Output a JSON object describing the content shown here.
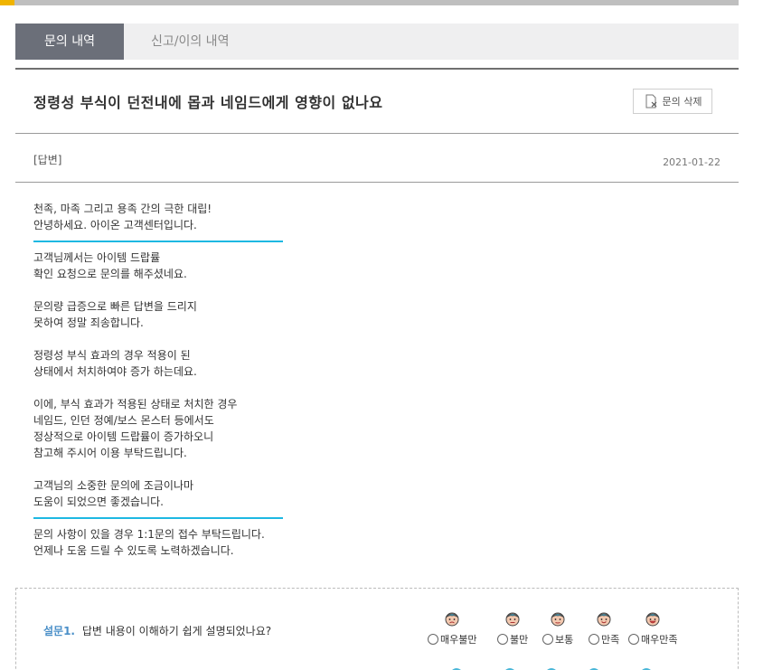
{
  "tabs": {
    "inquiry_history": "문의 내역",
    "report_history": "신고/이의 내역"
  },
  "question": {
    "title": "정령성 부식이 던전내에 몹과 네임드에게 영향이 없나요",
    "delete_label": "문의 삭제"
  },
  "answer": {
    "tag": "[답변]",
    "date": "2021-01-22",
    "greeting": "천족, 마족 그리고 용족 간의 극한 대립!\n안녕하세요. 아이온 고객센터입니다.",
    "paragraphs": [
      "고객님께서는 아이템 드랍률\n확인 요청으로 문의를 해주셨네요.",
      "문의량 급증으로 빠른 답변을 드리지\n못하여 정말 죄송합니다.",
      "정령성 부식 효과의 경우 적용이 된\n상태에서 처치하여야 증가 하는데요.",
      "이에, 부식 효과가 적용된 상태로 처치한 경우\n네임드, 인던 정예/보스 몬스터 등에서도\n정상적으로 아이템 드랍률이 증가하오니\n참고해 주시어 이용 부탁드립니다.",
      "고객님의 소중한 문의에 조금이나마\n도움이 되었으면 좋겠습니다."
    ],
    "closing": "문의 사항이 있을 경우 1:1문의 접수 부탁드립니다.\n언제나 도움 드릴 수 있도록 노력하겠습니다."
  },
  "survey": {
    "q1_number": "설문1.",
    "q1_text": "답변 내용이 이해하기 쉽게 설명되었나요?",
    "options": [
      "매우불만",
      "불만",
      "보통",
      "만족",
      "매우만족"
    ]
  },
  "colors": {
    "tab_active": "#6b6f79",
    "accent_line": "#1eb8e2",
    "survey_number": "#4a8fc8"
  }
}
